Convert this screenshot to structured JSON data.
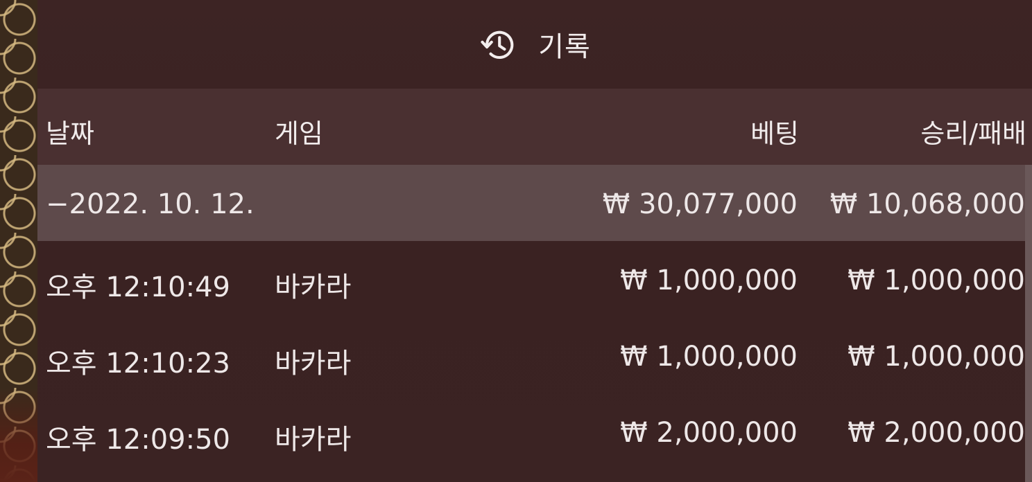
{
  "header": {
    "title": "기록",
    "icon": "history-icon"
  },
  "columns": {
    "date": "날짜",
    "game": "게임",
    "bet": "베팅",
    "winloss": "승리/패배"
  },
  "summary": {
    "date": "−2022. 10. 12.",
    "bet": "₩ 30,077,000",
    "winloss": "₩ 10,068,000"
  },
  "rows": [
    {
      "time": "오후 12:10:49",
      "game": "바카라",
      "bet": "₩ 1,000,000",
      "winloss": "₩ 1,000,000"
    },
    {
      "time": "오후 12:10:23",
      "game": "바카라",
      "bet": "₩ 1,000,000",
      "winloss": "₩ 1,000,000"
    },
    {
      "time": "오후 12:09:50",
      "game": "바카라",
      "bet": "₩ 2,000,000",
      "winloss": "₩ 2,000,000"
    }
  ],
  "colors": {
    "panel": "#3b2323",
    "header_row": "#4a3031",
    "summary_row": "#5e4a4b",
    "lattice_gold": "#d6ba82"
  }
}
